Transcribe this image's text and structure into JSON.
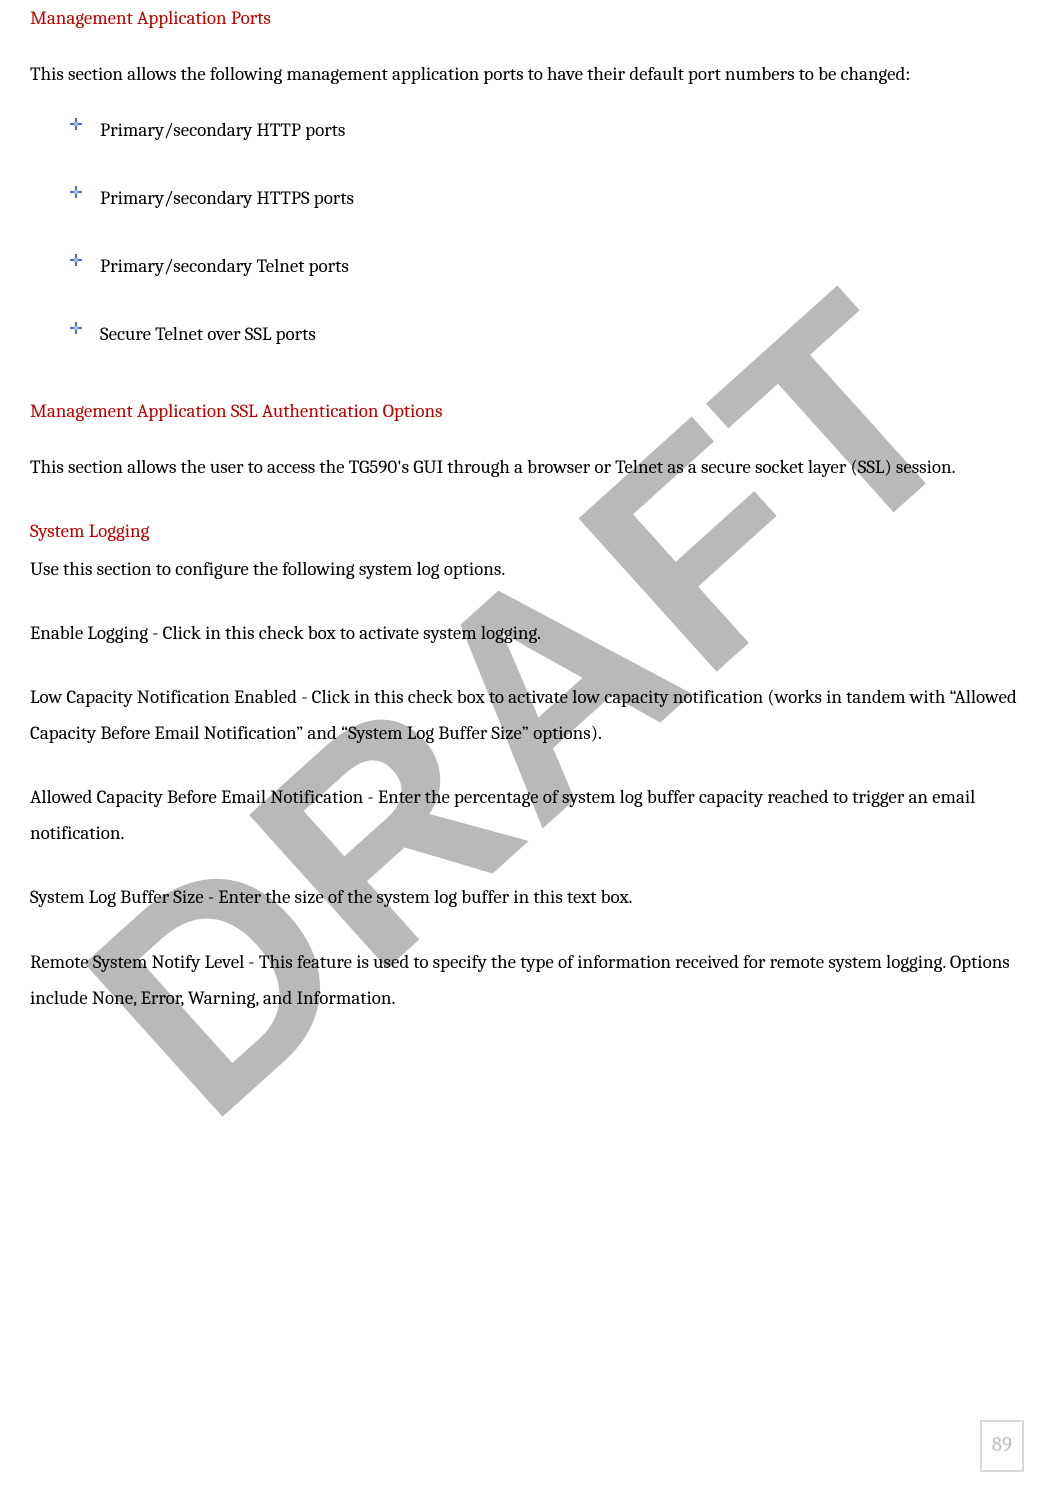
{
  "watermark": "DRAFT",
  "section1": {
    "heading": "Management Application Ports",
    "intro": "This section allows the following management application ports to have their default port numbers to be changed:",
    "bullets": [
      "Primary/secondary HTTP ports",
      "Primary/secondary HTTPS ports",
      "Primary/secondary Telnet ports",
      "Secure Telnet over SSL ports"
    ]
  },
  "section2": {
    "heading": "Management Application SSL Authentication Options",
    "intro": "This section allows the user to access the TG590's GUI through a browser or Telnet as a secure socket layer (SSL) session."
  },
  "section3": {
    "heading": "System Logging",
    "intro": "Use this section to configure the following system log options.",
    "paras": [
      "Enable Logging - Click in this check box to activate system logging.",
      "Low Capacity Notification Enabled - Click in this check box to activate low capacity notification (works in tandem with “Allowed Capacity Before Email Notification” and “System Log Buffer Size” options).",
      "Allowed Capacity Before Email Notification - Enter the percentage of system log buffer capacity reached to trigger an email notification.",
      "System Log Buffer Size - Enter the size of the system log buffer in this text box.",
      "Remote System Notify Level - This feature is used to specify the type of information received for remote system logging. Options include None, Error, Warning, and Information."
    ]
  },
  "pageNumber": "89"
}
